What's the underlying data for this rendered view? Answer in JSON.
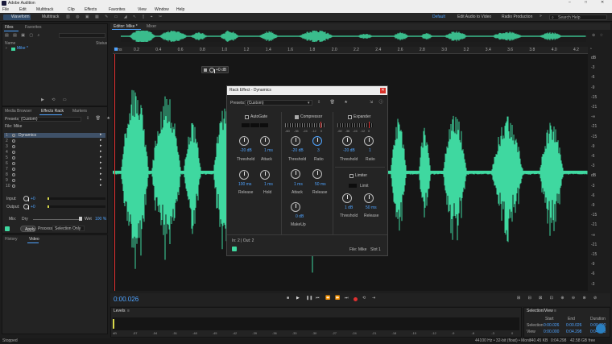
{
  "app": {
    "title": "Adobe Audition"
  },
  "menu": [
    "File",
    "Edit",
    "Multitrack",
    "Clip",
    "Effects",
    "Favorites",
    "View",
    "Window",
    "Help"
  ],
  "toolbar": {
    "waveform": "Waveform",
    "multitrack": "Multitrack",
    "default": "Default",
    "edit_video": "Edit Audio to Video",
    "radio": "Radio Production",
    "search_placeholder": "Search Help"
  },
  "files_panel": {
    "tab_files": "Files",
    "tab_favorites": "Favorites",
    "col_name": "Name",
    "col_status": "Status",
    "file_name": "Mike *"
  },
  "effects_panel": {
    "tab_media": "Media Browser",
    "tab_rack": "Effects Rack",
    "tab_markers": "Markers",
    "presets_label": "Presets:",
    "presets_value": "(Custom)",
    "file_label": "File: Mike",
    "slots": [
      {
        "num": "1",
        "name": "Dynamics"
      },
      {
        "num": "2",
        "name": ""
      },
      {
        "num": "3",
        "name": ""
      },
      {
        "num": "4",
        "name": ""
      },
      {
        "num": "5",
        "name": ""
      },
      {
        "num": "6",
        "name": ""
      },
      {
        "num": "7",
        "name": ""
      },
      {
        "num": "8",
        "name": ""
      },
      {
        "num": "9",
        "name": ""
      },
      {
        "num": "10",
        "name": ""
      }
    ],
    "input_label": "Input:",
    "input_val": "+0",
    "output_label": "Output:",
    "output_val": "+0",
    "mix_label": "Mix:",
    "dry": "Dry",
    "wet": "Wet",
    "mix_val": "100 %",
    "apply": "Apply",
    "process_label": "Process:",
    "process_value": "Selection Only"
  },
  "history_panel": {
    "tab_history": "History",
    "tab_video": "Video"
  },
  "editor": {
    "tab": "Editor: Mike *",
    "mixer": "Mixer",
    "gain_val": "+0 dB",
    "time": "0:00.026",
    "ruler": [
      "hms",
      "0.2",
      "0.4",
      "0.6",
      "0.8",
      "1.0",
      "1.2",
      "1.4",
      "1.6",
      "1.8",
      "2.0",
      "2.2",
      "2.4",
      "2.6",
      "2.8",
      "3.0",
      "3.2",
      "3.4",
      "3.6",
      "3.8",
      "4.0",
      "4.2"
    ],
    "db_scale": [
      "dB",
      "-3",
      "-6",
      "-9",
      "-15",
      "-21",
      "-∞",
      "-21",
      "-15",
      "-9",
      "-6",
      "-3",
      "dB",
      "-3",
      "-6",
      "-9",
      "-15",
      "-21",
      "-∞",
      "-21",
      "-15",
      "-9",
      "-6",
      "-3"
    ]
  },
  "rack_effect": {
    "title": "Rack Effect - Dynamics",
    "presets_label": "Presets:",
    "presets_value": "(Custom)",
    "autogate": "AutoGate",
    "compressor": "Compressor",
    "expander": "Expander",
    "limiter": "Limiter",
    "threshold": "Threshold",
    "attack": "Attack",
    "release": "Release",
    "hold": "Hold",
    "ratio": "Ratio",
    "makeup": "MakeUp",
    "limit": "Limit",
    "gate_threshold": "-20 dB",
    "gate_attack": "1 ms",
    "gate_release": "100 ms",
    "gate_hold": "1 ms",
    "comp_threshold": "-20 dB",
    "comp_ratio": "3",
    "comp_attack": "1 ms",
    "comp_release": "50 ms",
    "comp_makeup": "0 dB",
    "exp_threshold": "-20 dB",
    "exp_ratio": "1",
    "lim_threshold": "1 dB",
    "lim_release": "50 ms",
    "meter_labels": [
      "-60",
      "-36",
      "-24",
      "-12",
      "0"
    ],
    "io": "In: 2 | Out: 2",
    "file": "File: Mike",
    "slot": "Slot 1"
  },
  "transport": {},
  "levels": {
    "title": "Levels",
    "scale": [
      "dB",
      "-57",
      "-54",
      "-51",
      "-48",
      "-45",
      "-42",
      "-39",
      "-36",
      "-33",
      "-30",
      "-27",
      "-24",
      "-21",
      "-18",
      "-15",
      "-12",
      "-9",
      "-6",
      "-3",
      "0"
    ]
  },
  "selection_view": {
    "title": "Selection/View",
    "col_start": "Start",
    "col_end": "End",
    "col_duration": "Duration",
    "row_selection": "Selection",
    "row_view": "View",
    "sel_start": "0:00.026",
    "sel_end": "0:00.026",
    "sel_dur": "0:00.000",
    "view_start": "0:00.000",
    "view_end": "0:04.298",
    "view_dur": "0:04.298"
  },
  "status": {
    "left": "Stopped",
    "format": "44100 Hz • 32-bit (float) • Mono",
    "size": "740.45 KB",
    "dur": "0:04.298",
    "free": "42.58 GB free"
  },
  "colors": {
    "waveform": "#3fd8a0",
    "accent": "#4ea3ff",
    "playhead": "#e03030",
    "bg": "#1d1d1d"
  }
}
